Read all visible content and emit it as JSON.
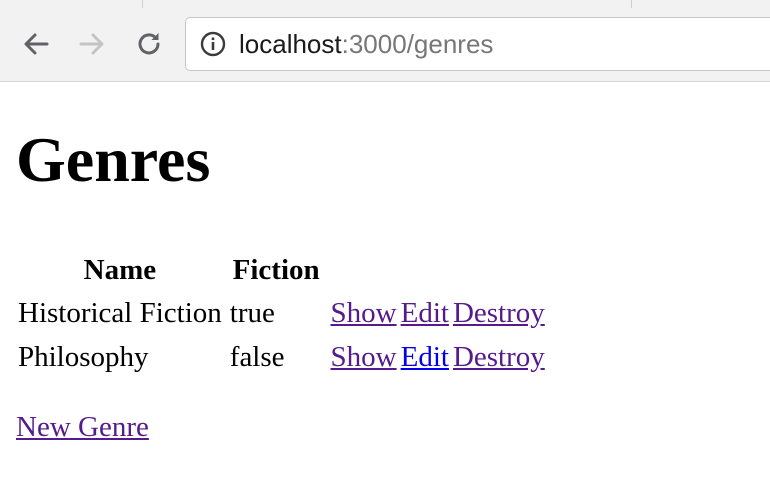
{
  "browser": {
    "url_host": "localhost",
    "url_rest": ":3000/genres"
  },
  "page": {
    "title": "Genres",
    "table": {
      "headers": [
        "Name",
        "Fiction",
        ""
      ],
      "rows": [
        {
          "name": "Historical Fiction",
          "fiction": "true",
          "show": "Show",
          "edit": "Edit",
          "destroy": "Destroy"
        },
        {
          "name": "Philosophy",
          "fiction": "false",
          "show": "Show",
          "edit": "Edit",
          "destroy": "Destroy"
        }
      ]
    },
    "new_link": "New Genre"
  },
  "colors": {
    "visited_link": "#551a8b",
    "unvisited_link": "#0000ee"
  },
  "icons": {
    "back": "arrow-left-icon",
    "forward": "arrow-right-icon",
    "reload": "reload-icon",
    "info": "info-icon"
  }
}
